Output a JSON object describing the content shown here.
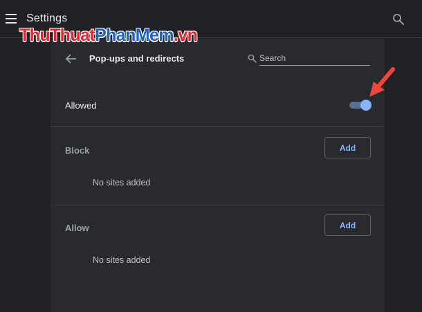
{
  "header": {
    "title": "Settings",
    "menu_icon": "hamburger-menu-icon",
    "search_icon": "search-icon"
  },
  "watermark": {
    "part1": "ThuThuat",
    "part2": "PhanMem",
    "part3": ".vn"
  },
  "page": {
    "title": "Pop-ups and redirects",
    "back_icon": "arrow-back-icon",
    "search_placeholder": "Search"
  },
  "main_setting": {
    "label": "Allowed",
    "enabled": true
  },
  "sections": [
    {
      "label": "Block",
      "add_label": "Add",
      "empty_text": "No sites added"
    },
    {
      "label": "Allow",
      "add_label": "Add",
      "empty_text": "No sites added"
    }
  ],
  "colors": {
    "background": "#202124",
    "card": "#292a2d",
    "accent": "#8ab4f8",
    "annotation": "#f0443c"
  }
}
